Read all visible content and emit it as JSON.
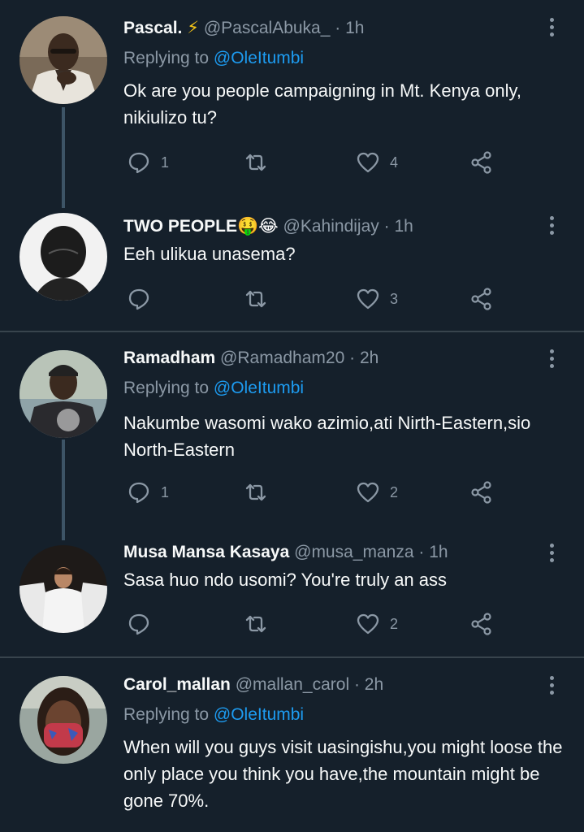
{
  "tweets": [
    {
      "name": "Pascal.",
      "badge": "⚡",
      "handle": "@PascalAbuka_",
      "time": "1h",
      "replying_label": "Replying to",
      "replying_mention": "@OleItumbi",
      "text": "Ok are you people campaigning in Mt. Kenya only, nikiulizo tu?",
      "reply_count": "1",
      "retweet_count": "",
      "like_count": "4"
    },
    {
      "name": "TWO PEOPLE",
      "badge": "🤑😂",
      "handle": "@Kahindijay",
      "time": "1h",
      "text": "Eeh ulikua unasema?",
      "reply_count": "",
      "retweet_count": "",
      "like_count": "3"
    },
    {
      "name": "Ramadham",
      "handle": "@Ramadham20",
      "time": "2h",
      "replying_label": "Replying to",
      "replying_mention": "@OleItumbi",
      "text": "Nakumbe wasomi wako azimio,ati Nirth-Eastern,sio North-Eastern",
      "reply_count": "1",
      "retweet_count": "",
      "like_count": "2"
    },
    {
      "name": "Musa Mansa Kasaya",
      "handle": "@musa_manza",
      "time": "1h",
      "text": "Sasa huo ndo usomi? You're truly an ass",
      "reply_count": "",
      "retweet_count": "",
      "like_count": "2"
    },
    {
      "name": "Carol_mallan",
      "handle": "@mallan_carol",
      "time": "2h",
      "replying_label": "Replying to",
      "replying_mention": "@OleItumbi",
      "text": "When will you guys visit uasingishu,you might loose the only place you think you have,the mountain might be gone 70%."
    }
  ],
  "separator": " · ",
  "icons": {
    "reply": "reply-icon",
    "retweet": "retweet-icon",
    "like": "heart-icon",
    "share": "share-icon",
    "more": "more-options-icon"
  },
  "colors": {
    "background": "#15202b",
    "secondary_text": "#8b98a5",
    "link": "#1d9bf0",
    "divider": "#38444d",
    "thread_line": "#3d5466"
  }
}
